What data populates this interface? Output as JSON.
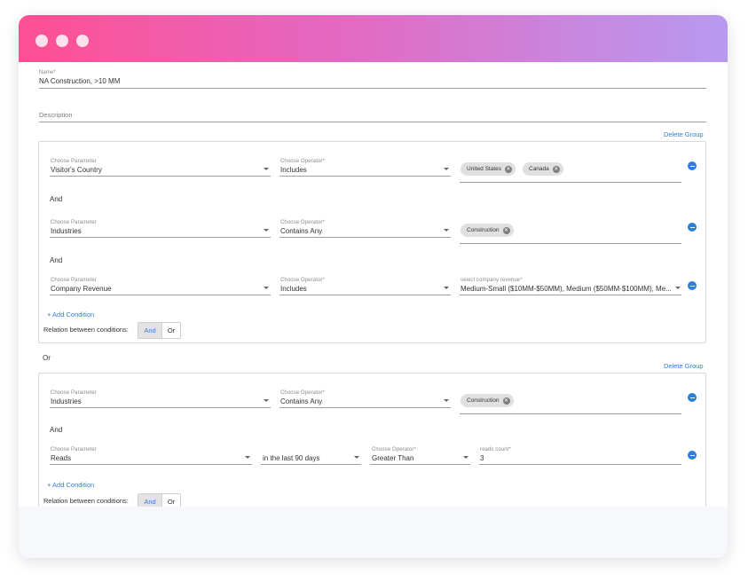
{
  "form": {
    "name_label": "Name*",
    "name_value": "NA Construction, >10 MM",
    "description_label": "Description"
  },
  "groups": [
    {
      "delete_label": "Delete Group",
      "conditions": [
        {
          "param_label": "Choose Parameter",
          "param_value": "Visitor's Country",
          "op_label": "Choose Operator*",
          "op_value": "Includes",
          "chips": [
            "United States",
            "Canada"
          ]
        },
        {
          "param_label": "Choose Parameter",
          "param_value": "Industries",
          "op_label": "Choose Operator*",
          "op_value": "Contains Any",
          "chips": [
            "Construction"
          ]
        },
        {
          "param_label": "Choose Parameter",
          "param_value": "Company Revenue",
          "op_label": "Choose Operator*",
          "op_value": "Includes",
          "value_label": "select company revenue*",
          "value_text": "Medium-Small ($10MM-$50MM), Medium ($50MM-$100MM), Me..."
        }
      ],
      "joiners": [
        "And",
        "And"
      ],
      "add_condition": "+ Add Condition",
      "relation_label": "Relation between conditions:",
      "relation_options": [
        "And",
        "Or"
      ]
    },
    {
      "delete_label": "Delete Group",
      "conditions": [
        {
          "param_label": "Choose Parameter",
          "param_value": "Industries",
          "op_label": "Choose Operator*",
          "op_value": "Contains Any",
          "chips": [
            "Construction"
          ]
        },
        {
          "param_label": "Choose Parameter",
          "param_value": "Reads",
          "period_value": "in the last 90 days",
          "op_label": "Choose Operator*",
          "op_value": "Greater Than",
          "count_label": "reads count*",
          "count_value": "3"
        }
      ],
      "joiners": [
        "And"
      ],
      "add_condition": "+ Add Condition",
      "relation_label": "Relation between conditions:",
      "relation_options": [
        "And",
        "Or"
      ]
    }
  ],
  "group_joiner": "Or"
}
